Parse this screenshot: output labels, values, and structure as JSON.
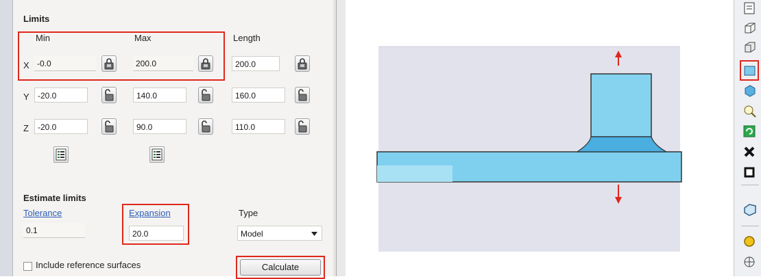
{
  "limits": {
    "title": "Limits",
    "headers": {
      "min": "Min",
      "max": "Max",
      "length": "Length"
    },
    "rows": [
      {
        "axis": "X",
        "min": "-0.0",
        "max": "200.0",
        "length": "200.0"
      },
      {
        "axis": "Y",
        "min": "-20.0",
        "max": "140.0",
        "length": "160.0"
      },
      {
        "axis": "Z",
        "min": "-20.0",
        "max": "90.0",
        "length": "110.0"
      }
    ]
  },
  "estimate": {
    "title": "Estimate limits",
    "tolerance_label": "Tolerance",
    "tolerance_value": "0.1",
    "expansion_label": "Expansion",
    "expansion_value": "20.0",
    "type_label": "Type",
    "type_value": "Model",
    "include_label": "Include reference surfaces",
    "calculate_label": "Calculate"
  },
  "colors": {
    "highlight": "#e0261b",
    "model_fill": "#7fd0ef",
    "background_zone": "#e2e2ec",
    "arrow": "#e0261b"
  },
  "toolbar_icons": [
    "file-icon",
    "block-icon",
    "block-icon-2",
    "box-icon",
    "cube-icon",
    "search-icon",
    "refresh-icon",
    "cross-icon",
    "square-icon",
    "shape-icon",
    "circle-icon",
    "crosshair-icon"
  ]
}
